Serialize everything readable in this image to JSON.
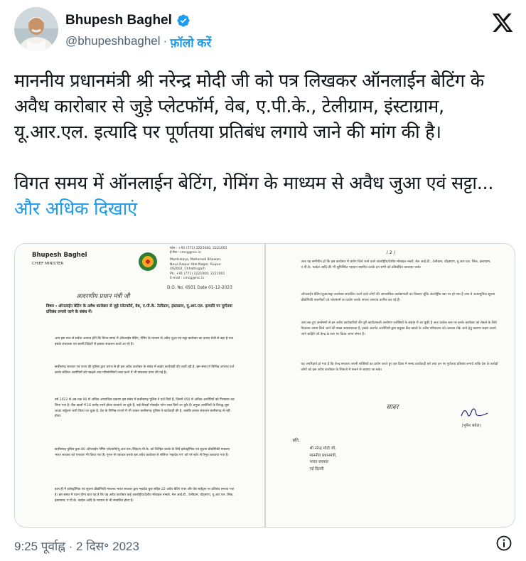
{
  "author": {
    "name": "Bhupesh Baghel",
    "handle": "@bhupeshbaghel",
    "separator": "·",
    "follow_label": "फ़ॉलो करें"
  },
  "icons": {
    "verified": "verified-badge-icon",
    "logo": "x-logo-icon",
    "info": "info-icon"
  },
  "colors": {
    "accent": "#1d9bf0",
    "text": "#0f1419",
    "muted": "#536471"
  },
  "tweet": {
    "paragraph1": "माननीय प्रधानमंत्री श्री नरेन्द्र मोदी जी को पत्र लिखकर ऑनलाईन बेटिंग के अवैध कारोबार से जुड़े प्लेटफॉर्म, वेब, ए.पी.के., टेलीग्राम, इंस्टाग्राम, यू.आर.एल. इत्यादि पर पूर्णतया प्रतिबंध लगाये जाने की मांग की है।",
    "paragraph2": "विगत समय में ऑनलाईन बेटिंग, गेमिंग के माध्यम से अवैध जुआ एवं सट्टा...",
    "show_more": "और अधिक दिखाएं"
  },
  "letter_page1": {
    "sender_name": "Bhupesh Baghel",
    "sender_title": "CHIEF MINISTER",
    "address": "Mantralaya, Mahanadi Bhawan,\nNava Raipur Atal Nagar, Raipur\n492002, Chhattisgarh\nPh. +91 (771) 2221000, 2221001\nE-mail : cmcg@nic.in",
    "contact_top": "फोन : +91 (771) 2221000, 2221001\nई-मेल : cmcg@nic.in",
    "handwritten_salutation": "आदरणीय प्रधान मंत्री जी",
    "dak_no": "D.O. No. 6931 Date 01-12-2023",
    "subject": "विषय : ऑनलाईन बेटिंग के अवैध कारोबार से जुड़े प्लेटफॉर्म, वेब, ए.पी.के. टेलीग्राम, इंस्टाग्राम, यू.आर.एल. इत्यादि पर पूर्णतया प्रतिबंध लगाये जाने के संबंध में।",
    "body_1": "आप इस तथ्य से सर्वथा अवगत होंगे कि विगत समय में ऑनलाईन बेटिंग, गेमिंग के माध्यम से अवैध जुआ एवं सट्टा कारोबार का दायरा तेजी से बढ़ा है तथा इसके संचालक एवं स्वामी विदेशों से इसका संचालन करते आ रहे हैं।",
    "body_2": "छत्तीसगढ़ सरकार एवं राज्य की पुलिस द्वारा प्रारंभ से ही इस अवैध कारोबार के संबंध में कठोर कार्यवाही की जाती रही है, इस संबंध में विभिन्न अपराध दर्ज करके संलिप्त आरोपियों को पकड़ने तथा परिसंपत्तियों जब्त करने में भी सफलता प्राप्त की गई है।",
    "body_3": "वर्ष 2022 से अब तक 90 से अधिक अपराधिक प्रकरण इस संबंध में छत्तीसगढ़ पुलिस ने दर्ज किये हैं, जिनमें 450 से अधिक आरोपियों को गिरफ्तार कर लिया गया है। बैंक खातों में 16 करोड़ रुपये होल्ड करवाये जा चुके हैं, कई सैकड़ों मोबाईल फोन जब्त किये जा चुके हैं। प्रमुख आरोपियों के विरुद्ध लुक आउट सर्कुलर जारी किया जा चुका है, देश के विभिन्न राज्यों में भी जाकर छत्तीसगढ़ पुलिस ने कार्यवाही की है, जबकि इनका संचालन छत्तीसगढ़ से नहीं होता।",
    "body_4": "छत्तीसगढ़ पुलिस द्वारा 80 ऑनलाईन गेमिंग प्लेटफॉर्म/यू.आर.एल./लिंक/ए.पी.के. को चिन्हित करके के लिये इलेक्ट्रॉनिक एवं सूचना प्रौद्योगिकी मंत्रालय भारत सरकार को पत्राचार भी किया गया है। गूगल से पत्राचार करके इस अवैध कारोबार से संलिप्त 'महादेव एप' को प्ले स्टोर से रिमूव करवाया गया है।",
    "body_5": "हाल ही में इलेक्ट्रॉनिक एवं सूचना प्रौद्योगिकी मंत्रालय भारत सरकार द्वारा महादेव बुक सहित 22 अवैध बेटिंग एप्स और वेब साईट्स पर प्रतिबंध लगाया गया है। इस संबंध में ध्यान योग्य बात यह है कि यह अवैध कारोबार कई अंतर्राष्ट्रीय/देशीय मोबाइल नम्बरों, मेल आई.डी., टेलीग्राम, वॉट्सएप, यू.आर.एल. लिंक, इंस्टाग्राम, ए.पी.के. फाईल आदि के माध्यम से भी संचालित होता है।"
  },
  "letter_page2": {
    "page_no": "/ 2 /",
    "body_1": "अतः यह समीचीन हो कि इस कारोबार में प्रयोग किये जाने वाले अंतर्राष्ट्रीय/देशीय मोबाइल नंबरों, मेल आई.डी., टेलीग्राम, वॉट्सएप, यू.आर.एल. लिंक, इंस्टाग्राम, ए.पी.के. फाईल आदि की भी सुनिश्चित पहचान स्थापित करके इन सभी को प्रतिबंधित करवाया जाये।",
    "body_2": "ऑनलाईन बेटिंग/जुआ/सट्टा कारोबार संचालित करने वाले लोगों की आपराधिक कार्यप्रणाली का विस्तार चूंकि अंतर्राष्ट्रीय स्तर पर हो गया है तथा ये अत्याधुनिक सूचना प्रौद्योगिकी तकनीकों एवं प्लेटफार्म का प्रयोग करके अपना अपराध कारित कर रहे हैं।",
    "body_3": "अब तक हुए अन्वेषणों से इन अवैध कारोबारियों की पूरी कार्यप्रणाली अन्वेषण एजेंसियों के संज्ञान में आ चुकी है अतः प्रत्येक स्तर पर इनके कारोबार को रोकने के लिये निवारक उपाय किये जाने की सख्त आवश्यकता है, इसके अंतर्गत आरोपियों द्वारा प्रयुक्त बैंक खातों के अवैध परिचालन को तत्काल रोके जाने हेतु कारगर कदम उठाये जाने चाहिये जो केन्द्र के स्तर पर किया जाना संभव है।",
    "body_4": "यह अपरिहार्य हो गया है कि केन्द्र सरकार अपनी शक्तियों का प्रयोग करते हुए इस दिशा में समग्र कार्यवाही करे तथा इन पर पूर्णतया प्रतिबंध लगाये ताकि देश के करोड़ों लोगों को इस अवैध कारोबार के शिकंजे में फंसने से बचाया जा सके।",
    "handwritten_closing": "सादर",
    "signatory": "(भूपेश बघेल)",
    "to_label": "प्रति,",
    "recipient": "श्री नरेन्द्र मोदी जी,\nमाननीय प्रधानमंत्री,\nभारत सरकार\nनई दिल्ली"
  },
  "timestamp": {
    "time": "9:25 पूर्वाह्न",
    "separator": "·",
    "date": "2 दिस॰ 2023"
  }
}
